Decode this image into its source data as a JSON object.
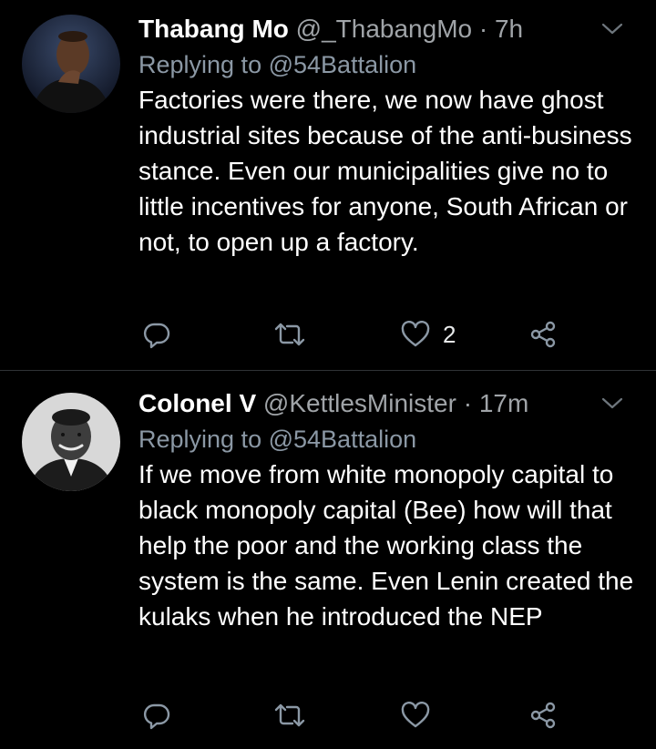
{
  "colors": {
    "background": "#000000",
    "divider": "#2f3336",
    "secondary_text": "#a0a4a8",
    "icon": "#8b98a5"
  },
  "tweets": [
    {
      "name": "Thabang Mo",
      "handle": "@_ThabangMo",
      "separator": "·",
      "time": "7h",
      "replying_prefix": "Replying to",
      "replying_to": "@54Battalion",
      "text": "Factories were there, we now have ghost industrial sites because of the anti-business stance. Even our municipalities give no to little incentives for anyone, South African or not, to open up a factory.",
      "like_count": "2",
      "icons": [
        "reply-icon",
        "retweet-icon",
        "like-icon",
        "share-icon",
        "chevron-down-icon"
      ]
    },
    {
      "name": "Colonel V",
      "handle": "@KettlesMinister",
      "separator": "·",
      "time": "17m",
      "replying_prefix": "Replying to",
      "replying_to": "@54Battalion",
      "text": "If we move from white monopoly capital to black monopoly capital (Bee) how will that help the poor and the working class the system is the same.  Even Lenin created the kulaks when he introduced the NEP",
      "icons": [
        "reply-icon",
        "retweet-icon",
        "like-icon",
        "share-icon",
        "chevron-down-icon"
      ]
    }
  ]
}
